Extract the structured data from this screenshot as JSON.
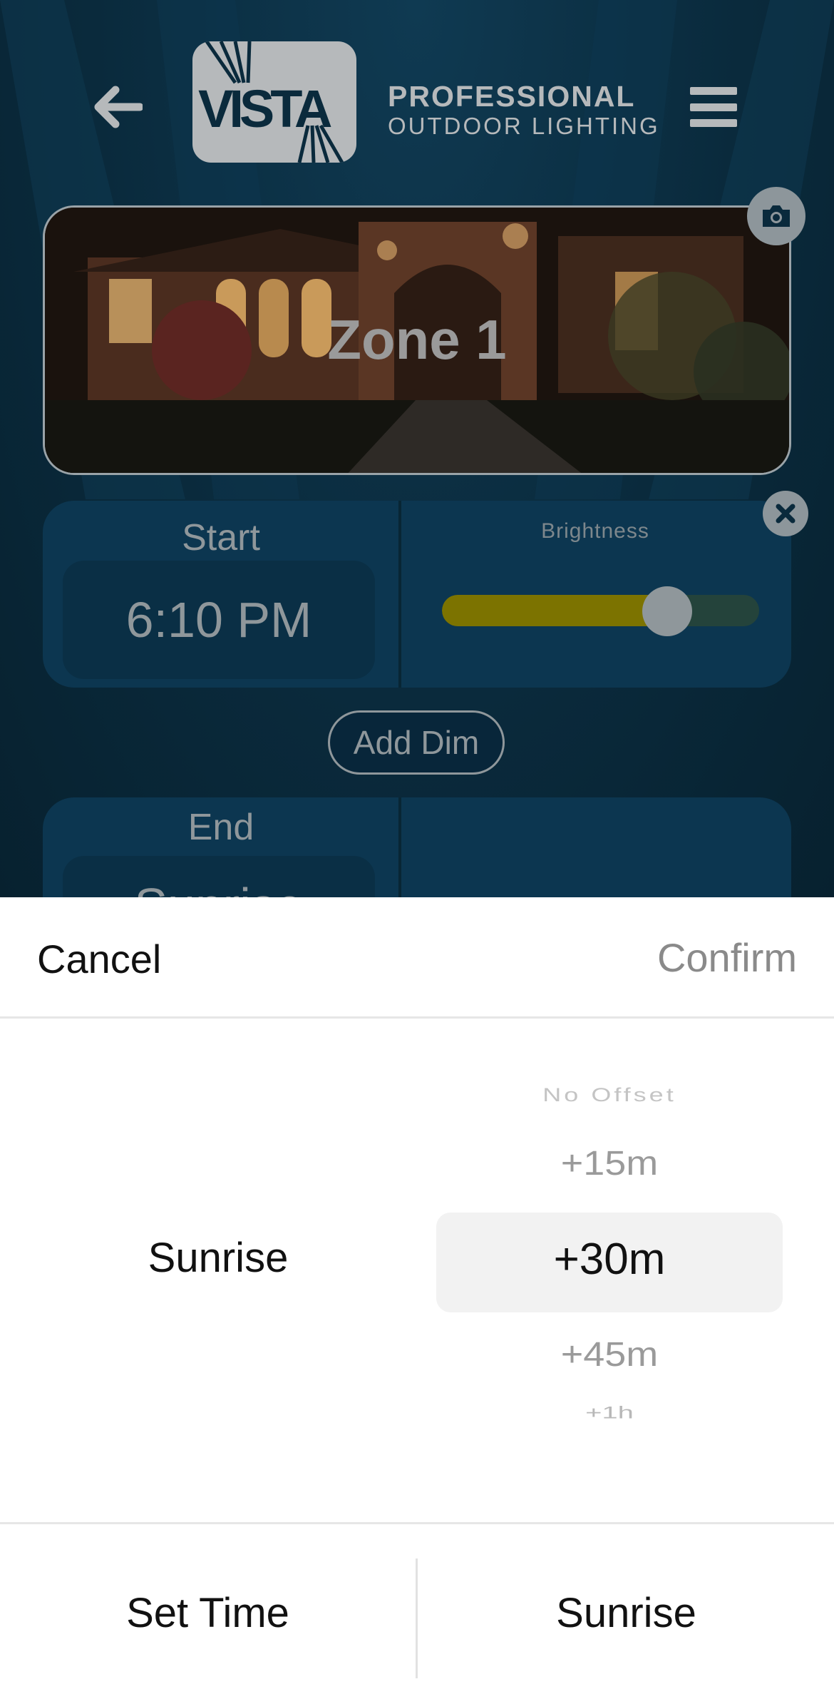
{
  "header": {
    "back_icon": "arrow-left-icon",
    "logo_word": "VISTA",
    "brand_line1": "PROFESSIONAL",
    "brand_line2": "OUTDOOR LIGHTING",
    "menu_icon": "hamburger-menu-icon"
  },
  "zone": {
    "title": "Zone 1",
    "camera_icon": "camera-icon",
    "close_icon": "close-icon"
  },
  "start": {
    "label": "Start",
    "time": "6:10 PM",
    "brightness_label": "Brightness",
    "brightness_level": 0.71
  },
  "add_dim_label": "Add Dim",
  "end": {
    "label": "End",
    "value": "Sunrise"
  },
  "sheet": {
    "cancel_label": "Cancel",
    "confirm_label": "Confirm",
    "left_column_value": "Sunrise",
    "offset_options": [
      "No Offset",
      "+15m",
      "+30m",
      "+45m",
      "+1h"
    ],
    "selected_offset": "+30m",
    "footer_left_label": "Set Time",
    "footer_right_label": "Sunrise"
  },
  "colors": {
    "background": "#0a2a3c",
    "panel": "#0c3650",
    "slider_fill": "#7c7300",
    "sheet": "#ffffff"
  }
}
